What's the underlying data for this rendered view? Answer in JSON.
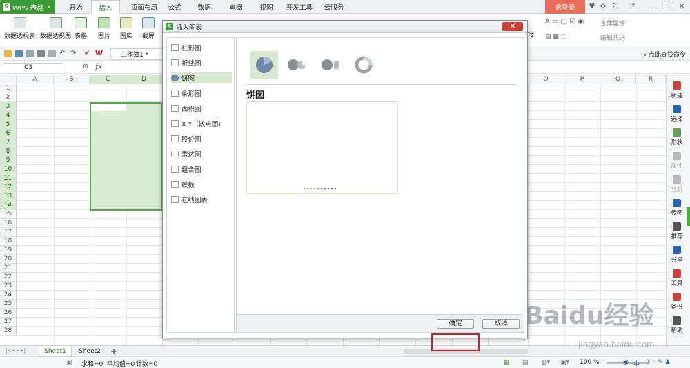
{
  "app": {
    "name": "WPS 表格",
    "logo_letter": "S"
  },
  "tabs": [
    {
      "label": "开始"
    },
    {
      "label": "插入",
      "active": true
    },
    {
      "label": "页面布局"
    },
    {
      "label": "公式"
    },
    {
      "label": "数据"
    },
    {
      "label": "审阅"
    },
    {
      "label": "视图"
    },
    {
      "label": "开发工具"
    },
    {
      "label": "云服务"
    }
  ],
  "login_label": "未登录",
  "ribbon": {
    "pivot_table": "数据透视表",
    "pivot_chart": "数据透视图",
    "table": "表格",
    "picture": "图片",
    "gallery": "图库",
    "screenshot": "截屏",
    "link_fragment": "接",
    "control_props": "查体属性",
    "edit_code": "编辑代码"
  },
  "quickbar": {
    "doc_tab": "工作簿1 *",
    "find_command": "点此查找命令"
  },
  "formula_bar": {
    "name_box": "C3",
    "fx": "fx",
    "value": ""
  },
  "grid": {
    "columns": [
      "A",
      "B",
      "C",
      "D",
      "O",
      "P",
      "Q",
      "R"
    ],
    "rows": [
      "1",
      "2",
      "3",
      "4",
      "5",
      "6",
      "7",
      "8",
      "9",
      "10",
      "11",
      "12",
      "13",
      "14",
      "15",
      "16",
      "17",
      "18",
      "19",
      "20",
      "21",
      "22",
      "23",
      "24",
      "25",
      "26",
      "27",
      "28"
    ]
  },
  "side_panel": {
    "items": [
      {
        "label": "新建",
        "dim": false
      },
      {
        "label": "选择",
        "dim": false
      },
      {
        "label": "形状",
        "dim": false
      },
      {
        "label": "属性",
        "dim": true
      },
      {
        "label": "分析",
        "dim": true
      },
      {
        "label": "传图",
        "dim": false
      },
      {
        "label": "推荐",
        "dim": false
      },
      {
        "label": "分享",
        "dim": false
      },
      {
        "label": "工具",
        "dim": false
      },
      {
        "label": "备份",
        "dim": false
      },
      {
        "label": "帮助",
        "dim": false
      }
    ]
  },
  "sheets": [
    {
      "label": "Sheet1",
      "active": true
    },
    {
      "label": "Sheet2",
      "active": false
    }
  ],
  "add_sheet": "+",
  "status": {
    "sum": "求和=0",
    "avg": "平均值=0",
    "count": "计数=0",
    "zoom": "100 %",
    "ime": "中"
  },
  "dialog": {
    "title": "插入图表",
    "close": "✕",
    "chart_types": [
      {
        "label": "柱形图",
        "icon": "column-chart-icon"
      },
      {
        "label": "折线图",
        "icon": "line-chart-icon"
      },
      {
        "label": "饼图",
        "icon": "pie-chart-icon",
        "active": true
      },
      {
        "label": "条形图",
        "icon": "bar-chart-icon"
      },
      {
        "label": "面积图",
        "icon": "area-chart-icon"
      },
      {
        "label": "X Y（散点图）",
        "icon": "scatter-chart-icon"
      },
      {
        "label": "股价图",
        "icon": "stock-chart-icon"
      },
      {
        "label": "雷达图",
        "icon": "radar-chart-icon"
      },
      {
        "label": "组合图",
        "icon": "combo-chart-icon"
      },
      {
        "label": "模板",
        "icon": "template-icon"
      },
      {
        "label": "在线图表",
        "icon": "online-chart-icon"
      }
    ],
    "selected_chart_name": "饼图",
    "ok": "确定",
    "cancel": "取消"
  },
  "watermark": {
    "brand": "Baidu经验",
    "url": "jingyan.baidu.com"
  },
  "colors": {
    "accent": "#3c9b37",
    "selection": "#d9ecd2",
    "login": "#e86d5a",
    "highlight": "#c8202a"
  }
}
